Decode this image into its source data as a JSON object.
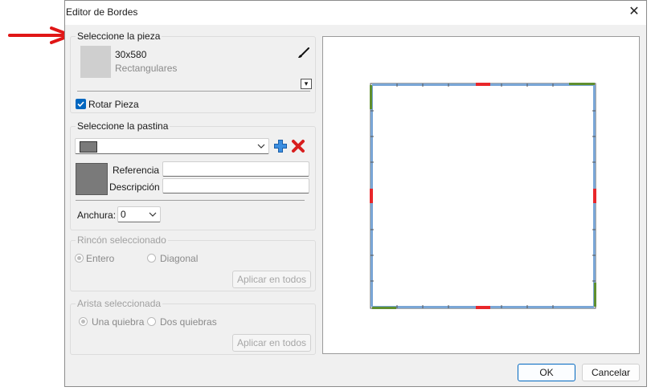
{
  "window": {
    "title": "Editor de Bordes",
    "close_glyph": "✕"
  },
  "piece": {
    "legend": "Seleccione la pieza",
    "size": "30x580",
    "type": "Rectangulares",
    "brush_icon": "brush-icon",
    "dropdown_glyph": "▾",
    "rotate_label": "Rotar Pieza",
    "rotate_checked": true
  },
  "pastina": {
    "legend": "Seleccione la pastina",
    "selected_color": "#7a7a7a",
    "add_icon": "plus-icon",
    "delete_icon": "x-icon",
    "referencia_label": "Referencia",
    "referencia_value": "",
    "descripcion_label": "Descripción",
    "descripcion_value": "",
    "anchura_label": "Anchura:",
    "anchura_value": "0"
  },
  "corner": {
    "legend": "Rincón seleccionado",
    "option_whole": "Entero",
    "option_diagonal": "Diagonal",
    "selected": "Entero",
    "apply_label": "Aplicar en todos"
  },
  "edge": {
    "legend": "Arista seleccionada",
    "option_one": "Una quiebra",
    "option_two": "Dos quiebras",
    "selected": "Una quiebra",
    "apply_label": "Aplicar en todos"
  },
  "footer": {
    "ok_label": "OK",
    "cancel_label": "Cancelar"
  },
  "colors": {
    "accent": "#0067c0",
    "edge_blue": "#7aa6d6",
    "edge_red": "#e8262a",
    "edge_green": "#5f8f2e",
    "annotation_red": "#e01616"
  }
}
